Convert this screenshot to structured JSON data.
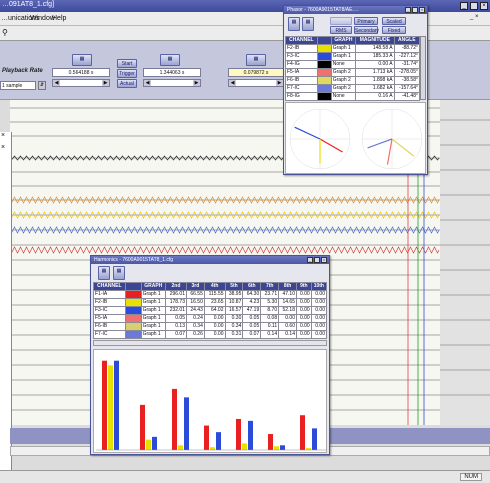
{
  "window": {
    "title": "…091AT8_1.cfg]"
  },
  "menu": {
    "items": [
      "…unications",
      "Window",
      "Help"
    ]
  },
  "playback": {
    "label": "Playback Rate",
    "rate_value": "1 sample",
    "cursor1": "0.564188 s",
    "cursor2": "1.344063 s",
    "delta": "0.079872 s",
    "start_label": "Start",
    "trigger_label": "Trigger",
    "actual_label": "Actual"
  },
  "phasor": {
    "title": "Phasor - 7600A9015TAT8/AE.…",
    "btn_primary": "Primary",
    "btn_scaled": "Scaled",
    "btn_rms": "RMS",
    "btn_secondary": "Secondary",
    "btn_fixed": "Fixed",
    "columns": [
      "CHANNEL",
      "GRAPH",
      "MAGNITUDE",
      "ANGLE"
    ],
    "rows": [
      {
        "channel": "F2-IB",
        "color": "#e8e000",
        "graph": "Graph 1",
        "mag": "148.58 A",
        "ang": "-88.72°"
      },
      {
        "channel": "F3-IC",
        "color": "#2a4cd8",
        "graph": "Graph 1",
        "mag": "185.33 A",
        "ang": "-227.12°"
      },
      {
        "channel": "F4-IG",
        "color": "#000000",
        "graph": "None",
        "mag": "0.00 A",
        "ang": "-31.74°"
      },
      {
        "channel": "F5-IA",
        "color": "#f0706e",
        "graph": "Graph 2",
        "mag": "1.713 kA",
        "ang": "-278.05°"
      },
      {
        "channel": "F6-IB",
        "color": "#e0d860",
        "graph": "Graph 2",
        "mag": "1.898 kA",
        "ang": "-38.58°"
      },
      {
        "channel": "F7-IC",
        "color": "#6a7ad8",
        "graph": "Graph 2",
        "mag": "1.682 kA",
        "ang": "-157.64°"
      },
      {
        "channel": "F8-IG",
        "color": "#000000",
        "graph": "None",
        "mag": "0.16 A",
        "ang": "-41.48°"
      }
    ]
  },
  "harmonics": {
    "title": "Harmonics - 7600A9015TAT8_1.cfg",
    "columns": [
      "CHANNEL",
      "GRAPH",
      "2nd",
      "3rd",
      "4th",
      "5th",
      "6th",
      "7th",
      "8th",
      "9th",
      "10th"
    ],
    "rows": [
      {
        "channel": "F1-IA",
        "color": "#e82020",
        "graph": "Graph 1",
        "vals": [
          "296.01",
          "66.55",
          "115.55",
          "38.95",
          "64.30",
          "23.71",
          "47.10",
          "0.00",
          "0.00"
        ]
      },
      {
        "channel": "F2-IB",
        "color": "#e8e000",
        "graph": "Graph 1",
        "vals": [
          "178.73",
          "16.50",
          "23.65",
          "10.87",
          "4.23",
          "5.30",
          "14.65",
          "0.00",
          "0.00"
        ]
      },
      {
        "channel": "F3-IC",
        "color": "#2a4cd8",
        "graph": "Graph 1",
        "vals": [
          "232.01",
          "24.43",
          "64.02",
          "16.57",
          "47.19",
          "8.70",
          "52.18",
          "0.00",
          "0.00"
        ]
      },
      {
        "channel": "F5-IA",
        "color": "#f0706e",
        "graph": "Graph 1",
        "vals": [
          "0.05",
          "0.24",
          "0.00",
          "0.30",
          "0.05",
          "0.08",
          "0.00",
          "0.00",
          "0.00"
        ]
      },
      {
        "channel": "F6-IB",
        "color": "#d8d070",
        "graph": "Graph 1",
        "vals": [
          "0.13",
          "0.34",
          "0.00",
          "0.34",
          "0.05",
          "0.11",
          "0.60",
          "0.00",
          "0.00"
        ]
      },
      {
        "channel": "F7-IC",
        "color": "#6a7ad8",
        "graph": "Graph 1",
        "vals": [
          "0.07",
          "0.26",
          "0.00",
          "0.31",
          "0.07",
          "0.14",
          "0.14",
          "0.00",
          "0.00"
        ]
      }
    ],
    "bars": [
      [
        0.95,
        0.9,
        0.95
      ],
      [
        0.48,
        0.11,
        0.14
      ],
      [
        0.65,
        0.05,
        0.56
      ],
      [
        0.26,
        0.03,
        0.19
      ],
      [
        0.33,
        0.07,
        0.31
      ],
      [
        0.17,
        0.04,
        0.05
      ],
      [
        0.37,
        0.02,
        0.23
      ]
    ]
  },
  "status": {
    "num": "NUM"
  },
  "colors": {
    "phase_a": "#e82020",
    "phase_b": "#e8e000",
    "phase_c": "#2a4cd8",
    "chrome": "#4b56a6"
  }
}
